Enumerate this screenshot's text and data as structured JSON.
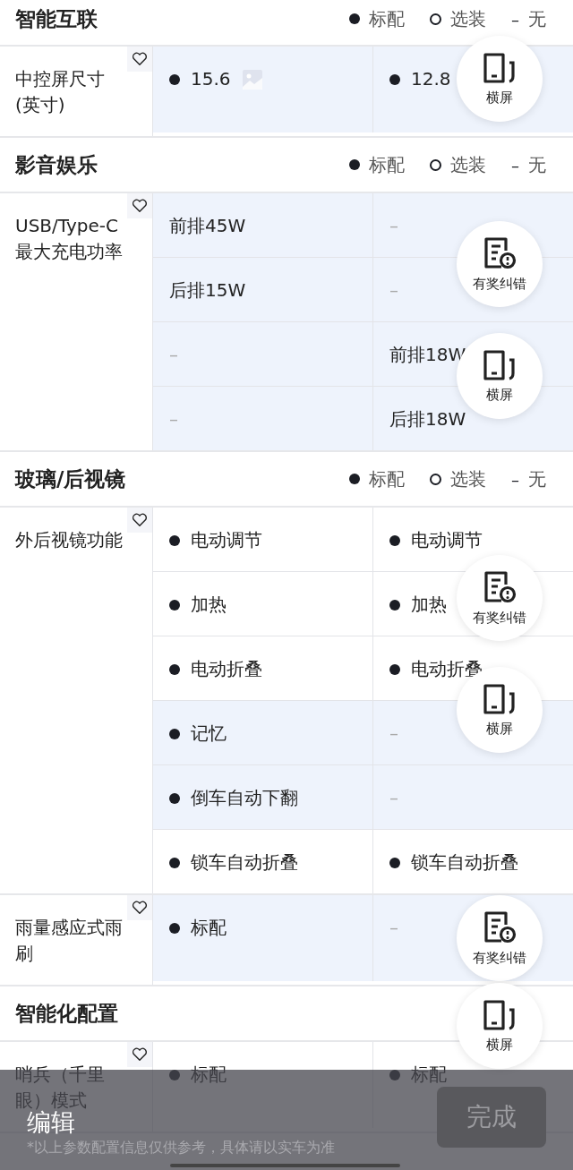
{
  "sections": [
    {
      "title": "智能互联",
      "legend": [
        {
          "kind": "standard",
          "label": "标配"
        },
        {
          "kind": "optional",
          "label": "选装"
        },
        {
          "kind": "none",
          "symbol": "–",
          "label": "无"
        }
      ],
      "rows": [
        {
          "label": "中控屏尺寸(英寸)",
          "lines": [
            {
              "highlight": true,
              "cells": [
                {
                  "kind": "standard",
                  "text": "15.6",
                  "image": true
                },
                {
                  "kind": "standard",
                  "text": "12.8"
                }
              ]
            }
          ]
        }
      ]
    },
    {
      "title": "影音娱乐",
      "legend": [
        {
          "kind": "standard",
          "label": "标配"
        },
        {
          "kind": "optional",
          "label": "选装"
        },
        {
          "kind": "none",
          "symbol": "–",
          "label": "无"
        }
      ],
      "rows": [
        {
          "label": "USB/Type-C最大充电功率",
          "lines": [
            {
              "highlight": true,
              "cells": [
                {
                  "kind": "plain",
                  "text": "前排45W"
                },
                {
                  "kind": "none",
                  "text": "–"
                }
              ]
            },
            {
              "highlight": true,
              "cells": [
                {
                  "kind": "plain",
                  "text": "后排15W"
                },
                {
                  "kind": "none",
                  "text": "–"
                }
              ]
            },
            {
              "highlight": true,
              "cells": [
                {
                  "kind": "none",
                  "text": "–"
                },
                {
                  "kind": "plain",
                  "text": "前排18W"
                }
              ]
            },
            {
              "highlight": true,
              "cells": [
                {
                  "kind": "none",
                  "text": "–"
                },
                {
                  "kind": "plain",
                  "text": "后排18W"
                }
              ]
            }
          ]
        }
      ]
    },
    {
      "title": "玻璃/后视镜",
      "legend": [
        {
          "kind": "standard",
          "label": "标配"
        },
        {
          "kind": "optional",
          "label": "选装"
        },
        {
          "kind": "none",
          "symbol": "–",
          "label": "无"
        }
      ],
      "rows": [
        {
          "label": "外后视镜功能",
          "lines": [
            {
              "highlight": false,
              "cells": [
                {
                  "kind": "standard",
                  "text": "电动调节"
                },
                {
                  "kind": "standard",
                  "text": "电动调节"
                }
              ]
            },
            {
              "highlight": false,
              "cells": [
                {
                  "kind": "standard",
                  "text": "加热"
                },
                {
                  "kind": "standard",
                  "text": "加热"
                }
              ]
            },
            {
              "highlight": false,
              "cells": [
                {
                  "kind": "standard",
                  "text": "电动折叠"
                },
                {
                  "kind": "standard",
                  "text": "电动折叠"
                }
              ]
            },
            {
              "highlight": true,
              "cells": [
                {
                  "kind": "standard",
                  "text": "记忆"
                },
                {
                  "kind": "none",
                  "text": "–"
                }
              ]
            },
            {
              "highlight": true,
              "cells": [
                {
                  "kind": "standard",
                  "text": "倒车自动下翻"
                },
                {
                  "kind": "none",
                  "text": "–"
                }
              ]
            },
            {
              "highlight": false,
              "cells": [
                {
                  "kind": "standard",
                  "text": "锁车自动折叠"
                },
                {
                  "kind": "standard",
                  "text": "锁车自动折叠"
                }
              ]
            }
          ]
        },
        {
          "label": "雨量感应式雨刷",
          "lines": [
            {
              "highlight": true,
              "cells": [
                {
                  "kind": "standard",
                  "text": "标配"
                },
                {
                  "kind": "none",
                  "text": "–"
                }
              ]
            }
          ]
        }
      ]
    },
    {
      "title": "智能化配置",
      "rows": [
        {
          "label": "哨兵（千里眼）模式",
          "lines": [
            {
              "highlight": false,
              "cells": [
                {
                  "kind": "standard",
                  "text": "标配"
                },
                {
                  "kind": "standard",
                  "text": "标配"
                }
              ]
            }
          ]
        }
      ]
    }
  ],
  "floating_buttons": [
    {
      "kind": "rotate",
      "label": "横屏"
    },
    {
      "kind": "feedback",
      "label": "有奖纠错"
    },
    {
      "kind": "rotate",
      "label": "横屏"
    },
    {
      "kind": "feedback",
      "label": "有奖纠错"
    },
    {
      "kind": "rotate",
      "label": "横屏"
    },
    {
      "kind": "feedback",
      "label": "有奖纠错"
    },
    {
      "kind": "rotate",
      "label": "横屏"
    }
  ],
  "bottom_bar": {
    "edit_label": "编辑",
    "note": "*以上参数配置信息仅供参考，具体请以实车为准",
    "done_button": {
      "label": "完成",
      "disabled": true
    }
  }
}
